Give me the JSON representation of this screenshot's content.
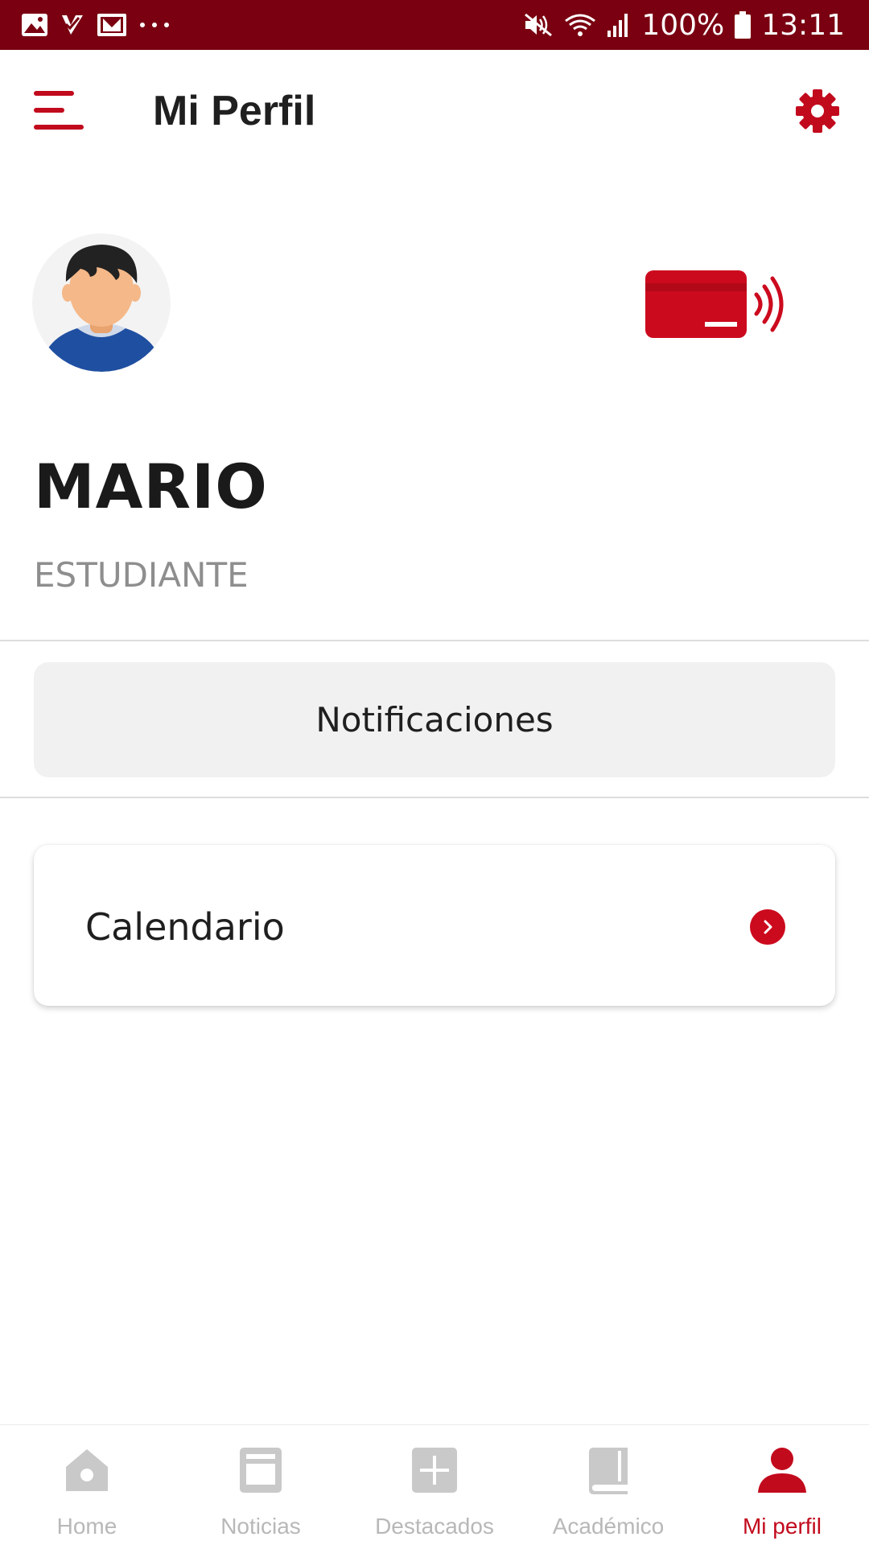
{
  "status_bar": {
    "battery": "100%",
    "time": "13:11",
    "left_icons": [
      "gallery-icon",
      "task-check-icon",
      "mail-icon",
      "more-dots-icon"
    ],
    "right_icons": [
      "mute-icon",
      "wifi-icon",
      "signal-icon",
      "battery-icon"
    ]
  },
  "header": {
    "title": "Mi Perfil",
    "menu_icon": "menu-icon",
    "settings_icon": "gear-icon"
  },
  "profile": {
    "name": "MARIO",
    "role": "ESTUDIANTE",
    "avatar_icon": "avatar-student",
    "card_icon": "contactless-card-icon"
  },
  "actions": {
    "notifications_label": "Notificaciones",
    "calendar_label": "Calendario"
  },
  "bottom_nav": {
    "items": [
      {
        "label": "Home",
        "icon": "home-icon"
      },
      {
        "label": "Noticias",
        "icon": "news-icon"
      },
      {
        "label": "Destacados",
        "icon": "plus-box-icon"
      },
      {
        "label": "Académico",
        "icon": "book-icon"
      },
      {
        "label": "Mi perfil",
        "icon": "person-icon"
      }
    ],
    "active_index": 4
  },
  "colors": {
    "status_bar": "#7a0011",
    "accent": "#cc0a1e",
    "inactive_nav": "#b8b8b8",
    "muted_text": "#8e8e8e"
  }
}
